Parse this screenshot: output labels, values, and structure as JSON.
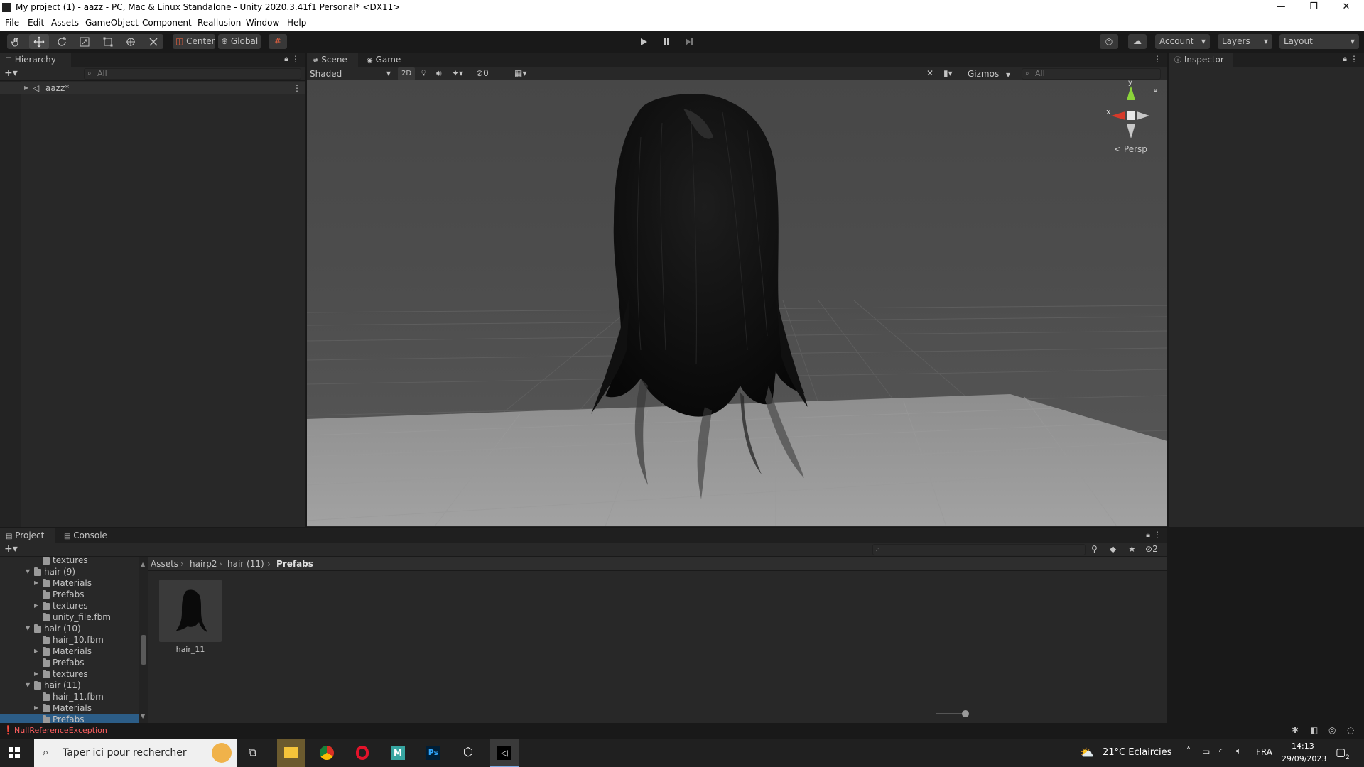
{
  "window": {
    "title": "My project (1) - aazz - PC, Mac & Linux Standalone - Unity 2020.3.41f1 Personal* <DX11>",
    "minimize": "—",
    "maximize": "❐",
    "close": "✕"
  },
  "menu": [
    "File",
    "Edit",
    "Assets",
    "GameObject",
    "Component",
    "Reallusion",
    "Window",
    "Help"
  ],
  "toolbar": {
    "pivot": "Center",
    "space": "Global",
    "account": "Account",
    "layers": "Layers",
    "layout": "Layout"
  },
  "hierarchy": {
    "tab": "Hierarchy",
    "search_placeholder": "All",
    "scene_name": "aazz*"
  },
  "scene": {
    "tab_scene": "Scene",
    "tab_game": "Game",
    "shading": "Shaded",
    "mode_2d": "2D",
    "hidden_count": "0",
    "gizmos": "Gizmos",
    "search_placeholder": "All",
    "projection": "Persp",
    "axis_x": "x",
    "axis_y": "y"
  },
  "inspector": {
    "tab": "Inspector"
  },
  "project": {
    "tab_project": "Project",
    "tab_console": "Console",
    "hidden_count": "2",
    "breadcrumb": [
      "Assets",
      "hairp2",
      "hair (11)",
      "Prefabs"
    ],
    "tree": [
      {
        "label": "textures",
        "indent": 2,
        "arrow": "",
        "partial": true
      },
      {
        "label": "hair (9)",
        "indent": 1,
        "arrow": "▼"
      },
      {
        "label": "Materials",
        "indent": 2,
        "arrow": "▶"
      },
      {
        "label": "Prefabs",
        "indent": 2,
        "arrow": ""
      },
      {
        "label": "textures",
        "indent": 2,
        "arrow": "▶"
      },
      {
        "label": "unity_file.fbm",
        "indent": 2,
        "arrow": ""
      },
      {
        "label": "hair (10)",
        "indent": 1,
        "arrow": "▼"
      },
      {
        "label": "hair_10.fbm",
        "indent": 2,
        "arrow": ""
      },
      {
        "label": "Materials",
        "indent": 2,
        "arrow": "▶"
      },
      {
        "label": "Prefabs",
        "indent": 2,
        "arrow": ""
      },
      {
        "label": "textures",
        "indent": 2,
        "arrow": "▶"
      },
      {
        "label": "hair (11)",
        "indent": 1,
        "arrow": "▼"
      },
      {
        "label": "hair_11.fbm",
        "indent": 2,
        "arrow": ""
      },
      {
        "label": "Materials",
        "indent": 2,
        "arrow": "▶"
      },
      {
        "label": "Prefabs",
        "indent": 2,
        "arrow": "",
        "selected": true
      }
    ],
    "assets": [
      {
        "label": "hair_11"
      }
    ]
  },
  "status": {
    "error": "NullReferenceException"
  },
  "taskbar": {
    "search_placeholder": "Taper ici pour rechercher",
    "weather": "21°C  Eclaircies",
    "lang": "FRA",
    "time": "14:13",
    "date": "29/09/2023",
    "notif_count": "2"
  },
  "colors": {
    "accent_blue": "#3a72b0",
    "error_red": "#ff5f5f",
    "panel": "#282828",
    "chrome": "#191919"
  }
}
